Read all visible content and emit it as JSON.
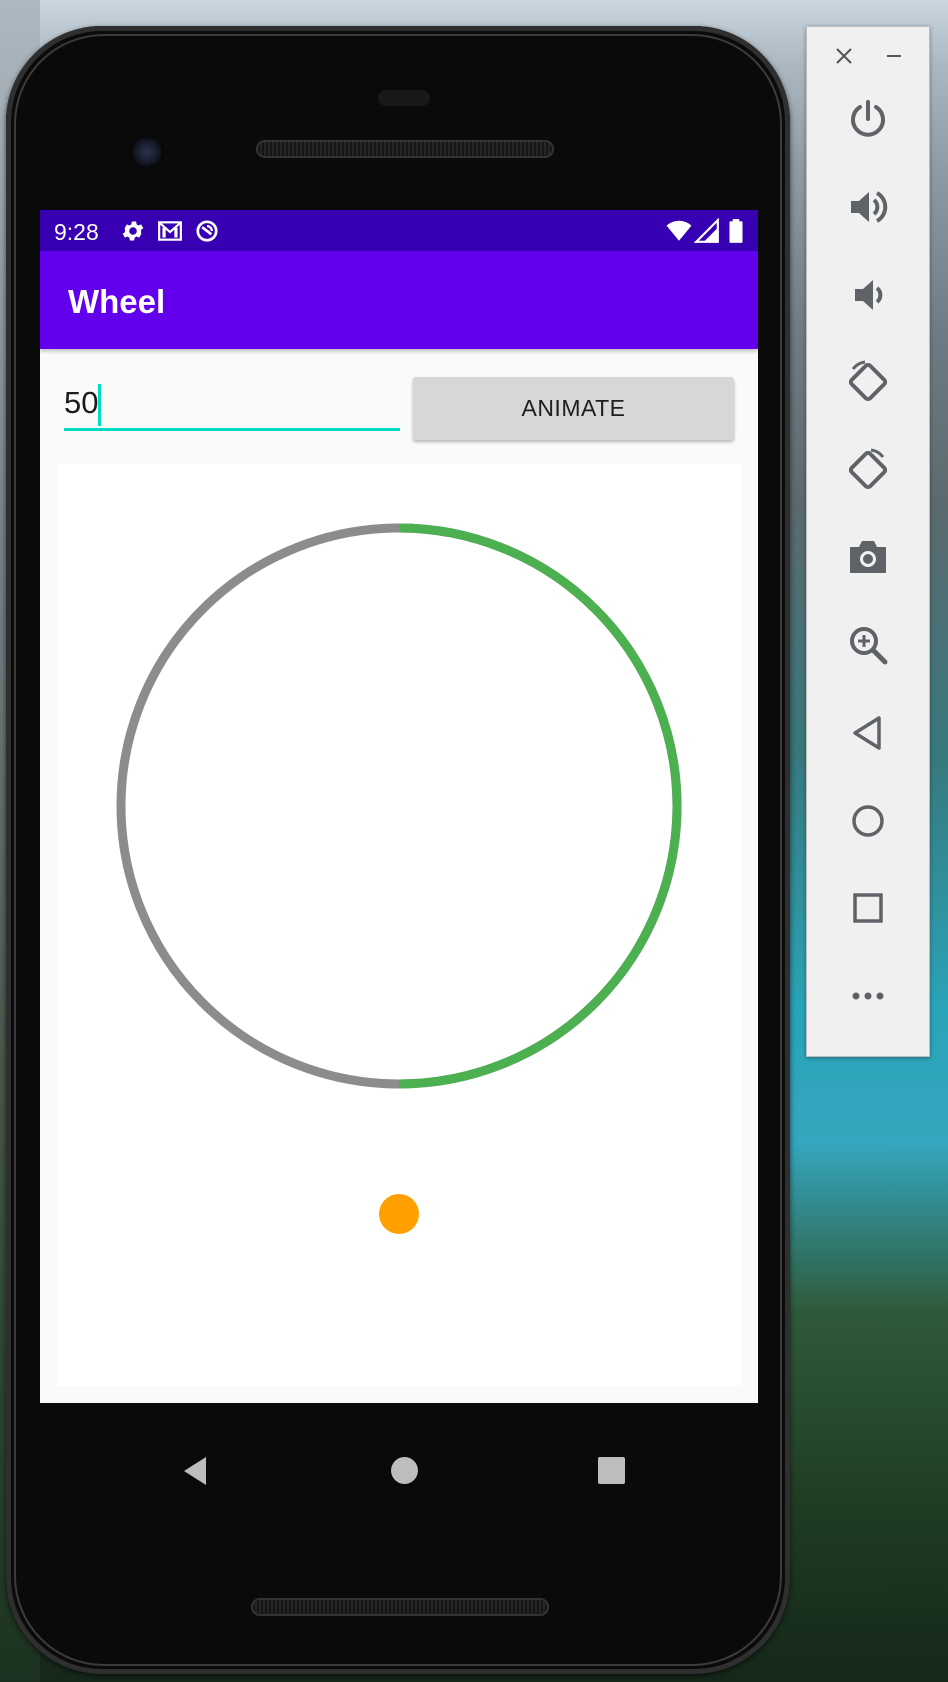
{
  "status_bar": {
    "time": "9:28"
  },
  "app_bar": {
    "title": "Wheel"
  },
  "controls": {
    "input_value": "50",
    "animate_label": "ANIMATE"
  },
  "wheel": {
    "progress_percent": 50,
    "track_color": "#8c8c8c",
    "progress_color": "#4caf50",
    "dot_color": "#ffa000"
  },
  "colors": {
    "status_bar": "#3700b3",
    "app_bar": "#6200ee",
    "accent": "#03dac5"
  },
  "emulator_toolbar": {
    "window_buttons": [
      "close-icon",
      "minimize-icon"
    ],
    "buttons": [
      "power-icon",
      "volume-up-icon",
      "volume-down-icon",
      "rotate-left-icon",
      "rotate-right-icon",
      "camera-icon",
      "zoom-icon",
      "back-icon",
      "home-icon",
      "overview-icon",
      "more-icon"
    ]
  },
  "nav_bar": {
    "buttons": [
      "back-icon",
      "home-icon",
      "recents-icon"
    ]
  }
}
